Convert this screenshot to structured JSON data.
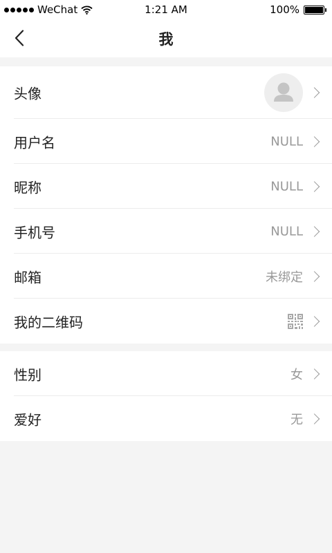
{
  "status_bar": {
    "carrier": "WeChat",
    "time": "1:21 AM",
    "battery": "100%",
    "battery_level": 1.0,
    "signal_icon": "signal-dots-icon",
    "wifi_icon": "wifi-icon",
    "battery_icon": "battery-icon"
  },
  "nav": {
    "title": "我",
    "back_icon": "back-chevron-icon"
  },
  "profile": {
    "avatar_label": "头像",
    "avatar_icon": "default-user-avatar-icon",
    "rows": [
      {
        "label": "用户名",
        "value": "NULL"
      },
      {
        "label": "昵称",
        "value": "NULL"
      },
      {
        "label": "手机号",
        "value": "NULL"
      },
      {
        "label": "邮箱",
        "value": "未绑定"
      }
    ],
    "qr_label": "我的二维码",
    "qr_icon": "qr-code-icon"
  },
  "details": {
    "rows": [
      {
        "label": "性别",
        "value": "女"
      },
      {
        "label": "爱好",
        "value": "无"
      }
    ]
  },
  "colors": {
    "background": "#f4f4f4",
    "surface": "#ffffff",
    "text_primary": "#222222",
    "text_secondary": "#999999",
    "divider": "#ececec"
  }
}
